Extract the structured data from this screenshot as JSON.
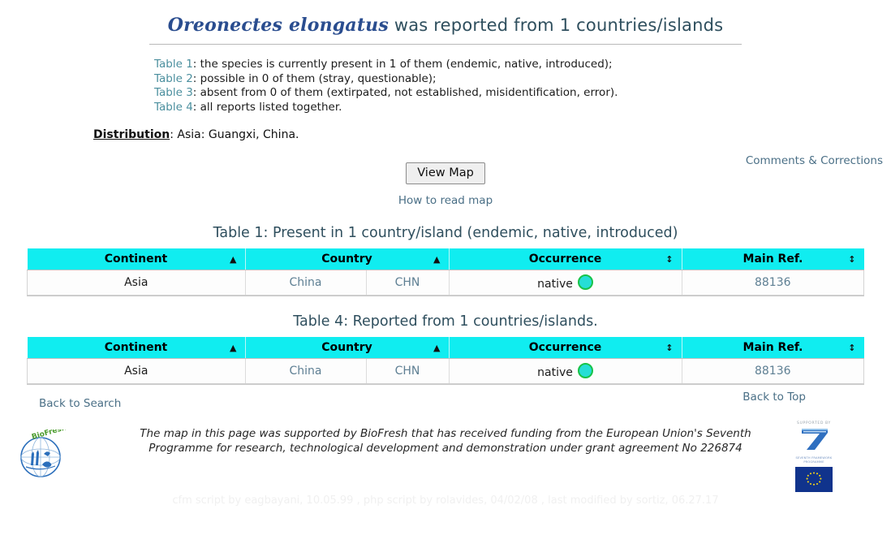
{
  "header": {
    "species_name": "Oreonectes elongatus",
    "title_rest": " was reported from 1 countries/islands"
  },
  "legend": {
    "lines": [
      {
        "link": "Table 1",
        "text": ": the species is currently present in 1 of them (endemic, native, introduced);"
      },
      {
        "link": "Table 2",
        "text": ": possible in 0 of them (stray, questionable);"
      },
      {
        "link": "Table 3",
        "text": ": absent from 0 of them (extirpated, not established, misidentification, error)."
      },
      {
        "link": "Table 4",
        "text": ": all reports listed together."
      }
    ]
  },
  "distribution": {
    "label": "Distribution",
    "value": ": Asia: Guangxi, China."
  },
  "links": {
    "comments": "Comments & Corrections",
    "how_to_read_map": "How to read map",
    "back_to_search": "Back to Search",
    "back_to_top": "Back to Top"
  },
  "buttons": {
    "view_map": "View Map"
  },
  "tables": [
    {
      "caption": "Table 1: Present in 1 country/island (endemic, native, introduced)",
      "columns": [
        {
          "label": "Continent",
          "sort": "asc"
        },
        {
          "label": "Country",
          "sort": "asc"
        },
        {
          "label": "Occurrence",
          "sort": "none"
        },
        {
          "label": "Main Ref.",
          "sort": "none"
        }
      ],
      "rows": [
        {
          "continent": "Asia",
          "country": "China",
          "country_code": "CHN",
          "occurrence": "native",
          "occurrence_color": "#25ded6",
          "occurrence_border": "#18c348",
          "main_ref": "88136"
        }
      ]
    },
    {
      "caption": "Table 4: Reported from 1 countries/islands.",
      "columns": [
        {
          "label": "Continent",
          "sort": "asc"
        },
        {
          "label": "Country",
          "sort": "asc"
        },
        {
          "label": "Occurrence",
          "sort": "none"
        },
        {
          "label": "Main Ref.",
          "sort": "none"
        }
      ],
      "rows": [
        {
          "continent": "Asia",
          "country": "China",
          "country_code": "CHN",
          "occurrence": "native",
          "occurrence_color": "#25ded6",
          "occurrence_border": "#18c348",
          "main_ref": "88136"
        }
      ]
    }
  ],
  "footer": {
    "funding_note": "The map in this page was supported by BioFresh that has received funding from the European Union's Seventh Programme for research, technological development and demonstration under grant agreement No 226874",
    "supported_by": "SUPPORTED BY",
    "fp7_label": "SEVENTH FRAMEWORK PROGRAMME",
    "biofresh_label": "BioFresh",
    "credits": "cfm script by eagbayani, 10.05.99 ,  php script by rolavides, 04/02/08 ,  last modified by sortiz, 06.27.17"
  },
  "theme": {
    "header_cyan": "#10edf0",
    "link_blue": "#4a6f86",
    "title_blue": "#2a4d8f",
    "caption_color": "#2f4f5e"
  },
  "sort_glyphs": {
    "asc": "▲",
    "desc": "▼",
    "none": "↕"
  }
}
